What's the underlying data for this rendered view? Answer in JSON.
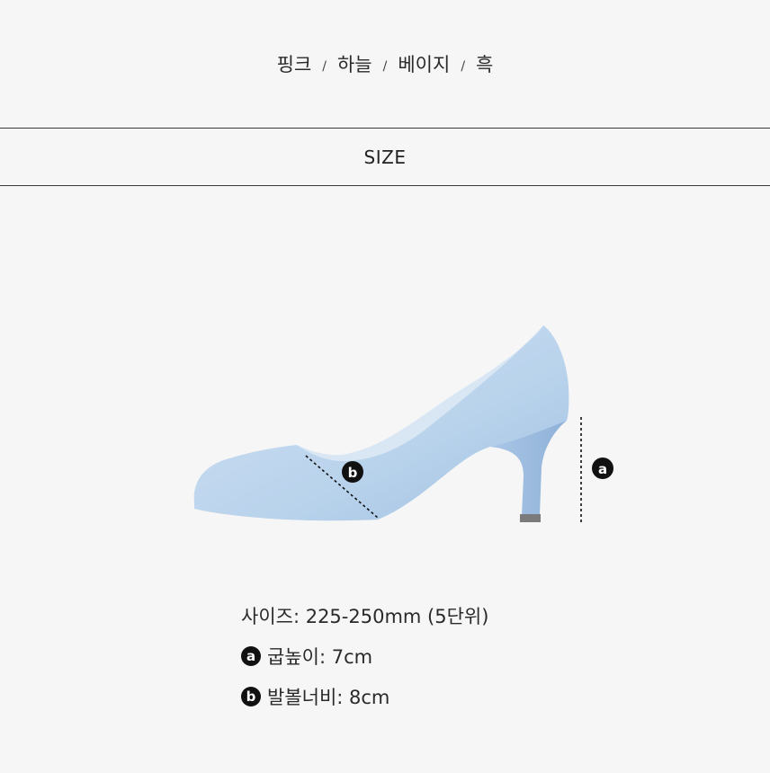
{
  "color_options": [
    "핑크",
    "하늘",
    "베이지",
    "흑"
  ],
  "separator": "/",
  "size_heading": "SIZE",
  "markers": {
    "a": "a",
    "b": "b"
  },
  "specs": {
    "size_line": "사이즈: 225-250mm (5단위)",
    "heel_height": "굽높이: 7cm",
    "ball_width": "발볼너비: 8cm"
  },
  "colors": {
    "shoe": "#b9d3ec",
    "background": "#f6f6f6",
    "badge": "#111111"
  }
}
